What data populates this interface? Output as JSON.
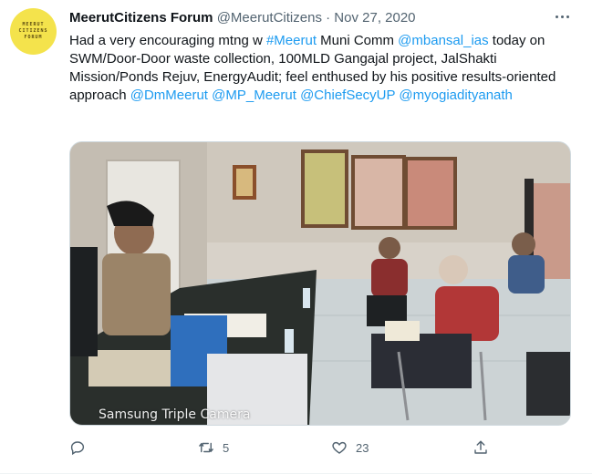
{
  "tweet": {
    "avatar_lines": [
      "MEERUT",
      "CITIZENS",
      "FORUM"
    ],
    "author_name": "MeerutCitizens Forum",
    "author_handle": "@MeerutCitizens",
    "separator": "·",
    "date": "Nov 27, 2020",
    "text_parts": [
      {
        "t": "Had a very encouraging mtng w ",
        "link": false
      },
      {
        "t": "#Meerut",
        "link": true
      },
      {
        "t": " Muni Comm ",
        "link": false
      },
      {
        "t": "@mbansal_ias",
        "link": true
      },
      {
        "t": " today on SWM/Door-Door waste collection, 100MLD Gangajal project, JalShakti Mission/Ponds Rejuv, EnergyAudit; feel enthused by his positive results-oriented approach ",
        "link": false
      },
      {
        "t": "@DmMeerut",
        "link": true
      },
      {
        "t": " ",
        "link": false
      },
      {
        "t": "@MP_Meerut",
        "link": true
      },
      {
        "t": " ",
        "link": false
      },
      {
        "t": "@ChiefSecyUP",
        "link": true
      },
      {
        "t": " ",
        "link": false
      },
      {
        "t": "@myogiadityanath",
        "link": true
      }
    ],
    "photo_watermark": "Samsung Triple Camera",
    "actions": {
      "reply_icon": "reply-icon",
      "retweet_icon": "retweet-icon",
      "retweet_count": "5",
      "like_icon": "heart-icon",
      "like_count": "23",
      "share_icon": "share-icon"
    }
  },
  "colors": {
    "link": "#1d9bf0",
    "secondary_text": "#536471",
    "avatar_bg": "#f4e34c"
  }
}
